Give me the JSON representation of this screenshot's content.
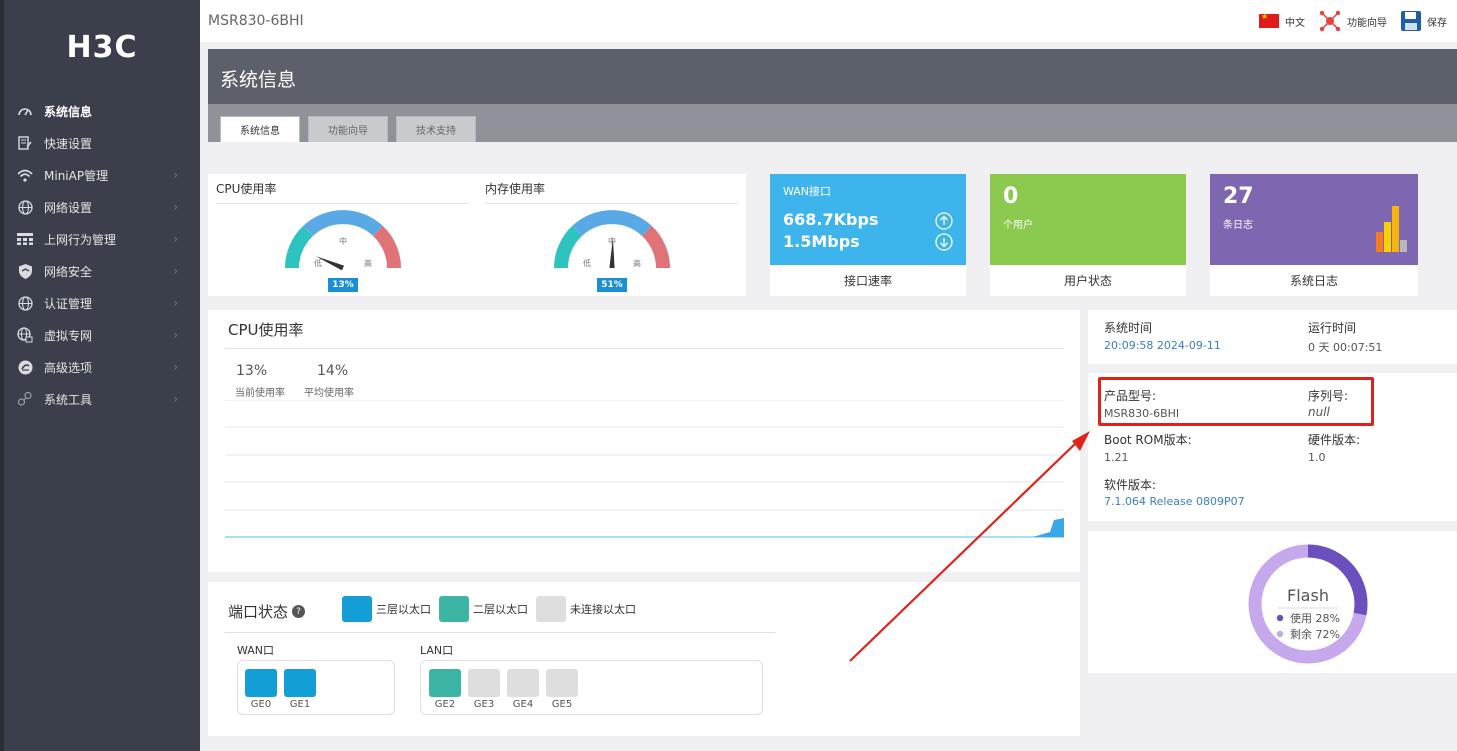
{
  "app": {
    "logo": "H3C",
    "device_title": "MSR830-6BHI"
  },
  "topbar": {
    "lang_label": "中文",
    "wizard_label": "功能向导",
    "save_label": "保存"
  },
  "sidebar": {
    "items": [
      {
        "label": "系统信息",
        "icon": "speedometer-icon",
        "active": true
      },
      {
        "label": "快速设置",
        "icon": "edit-icon"
      },
      {
        "label": "MiniAP管理",
        "icon": "wifi-icon"
      },
      {
        "label": "网络设置",
        "icon": "globe-icon"
      },
      {
        "label": "上网行为管理",
        "icon": "grid-icon"
      },
      {
        "label": "网络安全",
        "icon": "shield-icon"
      },
      {
        "label": "认证管理",
        "icon": "globe-icon"
      },
      {
        "label": "虚拟专网",
        "icon": "vpn-icon"
      },
      {
        "label": "高级选项",
        "icon": "options-icon"
      },
      {
        "label": "系统工具",
        "icon": "tools-icon"
      }
    ]
  },
  "page": {
    "title": "系统信息",
    "tabs": [
      {
        "label": "系统信息",
        "active": true
      },
      {
        "label": "功能向导"
      },
      {
        "label": "技术支持"
      }
    ]
  },
  "gauges": {
    "cpu": {
      "title": "CPU使用率",
      "percent": 13,
      "badge": "13%",
      "low": "低",
      "mid": "中",
      "high": "高"
    },
    "memory": {
      "title": "内存使用率",
      "percent": 51,
      "badge": "51%",
      "low": "低",
      "mid": "中",
      "high": "高"
    }
  },
  "tiles": {
    "wan": {
      "title": "WAN接口",
      "up": "668.7Kbps",
      "down": "1.5Mbps",
      "footer": "接口速率",
      "color": "#3db4ec"
    },
    "users": {
      "count": "0",
      "unit": "个用户",
      "footer": "用户状态",
      "color": "#8cc94f"
    },
    "logs": {
      "count": "27",
      "unit": "条日志",
      "footer": "系统日志",
      "color": "#7f66b0"
    }
  },
  "cpu_chart": {
    "title": "CPU使用率",
    "current_value": "13%",
    "current_label": "当前使用率",
    "average_value": "14%",
    "average_label": "平均使用率"
  },
  "ports": {
    "title": "端口状态",
    "legend": {
      "l3": "三层以太口",
      "l2": "二层以太口",
      "down": "未连接以太口"
    },
    "wan_label": "WAN口",
    "lan_label": "LAN口",
    "wan": [
      {
        "name": "GE0",
        "state": "l3"
      },
      {
        "name": "GE1",
        "state": "l3"
      }
    ],
    "lan": [
      {
        "name": "GE2",
        "state": "l2"
      },
      {
        "name": "GE3",
        "state": "down"
      },
      {
        "name": "GE4",
        "state": "down"
      },
      {
        "name": "GE5",
        "state": "down"
      }
    ]
  },
  "sysinfo": {
    "time_label": "系统时间",
    "time_value": "20:09:58  2024-09-11",
    "uptime_label": "运行时间",
    "uptime_value": "0 天  00:07:51",
    "model_label": "产品型号:",
    "model_value": "MSR830-6BHI",
    "serial_label": "序列号:",
    "serial_value": "null",
    "bootrom_label": "Boot ROM版本:",
    "bootrom_value": "1.21",
    "hardware_label": "硬件版本:",
    "hardware_value": "1.0",
    "software_label": "软件版本:",
    "software_value": "7.1.064 Release 0809P07"
  },
  "flash": {
    "title": "Flash",
    "used_label": "使用 28%",
    "free_label": "剩余 72%",
    "used_percent": 28,
    "used_color": "#6b4fbf",
    "free_color": "#c6a8ec"
  }
}
